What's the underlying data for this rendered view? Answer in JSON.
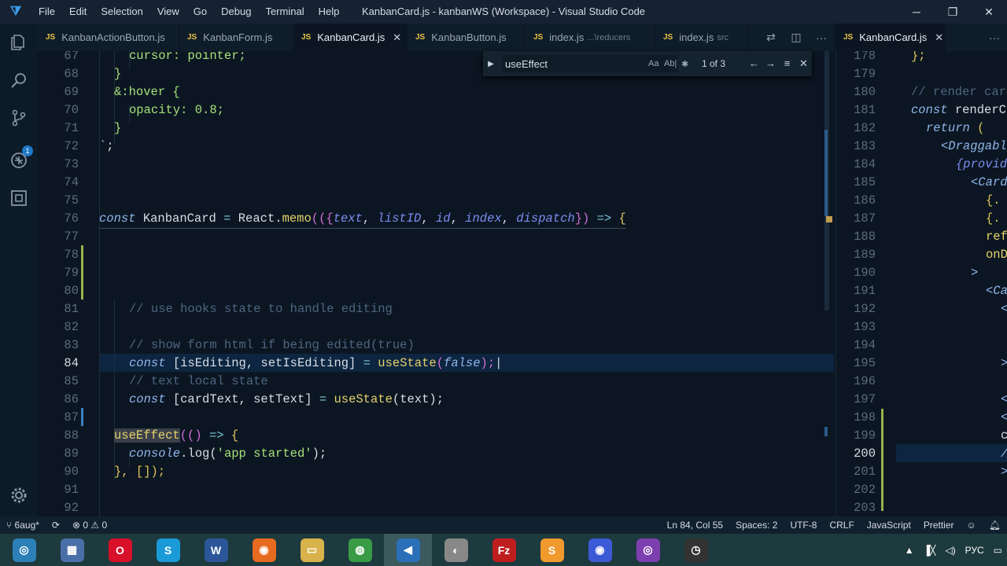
{
  "window": {
    "title": "KanbanCard.js - kanbanWS (Workspace) - Visual Studio Code",
    "menu": [
      "File",
      "Edit",
      "Selection",
      "View",
      "Go",
      "Debug",
      "Terminal",
      "Help"
    ],
    "minimize": "─",
    "restore": "❐",
    "close": "✕"
  },
  "tabs": [
    {
      "name": "KanbanActionButton.js",
      "sub": ""
    },
    {
      "name": "KanbanForm.js",
      "sub": ""
    },
    {
      "name": "KanbanCard.js",
      "sub": ""
    },
    {
      "name": "KanbanButton.js",
      "sub": ""
    },
    {
      "name": "index.js",
      "sub": "...\\reducers"
    },
    {
      "name": "index.js",
      "sub": "src"
    }
  ],
  "tabs2": [
    {
      "name": "KanbanCard.js"
    }
  ],
  "js_label": "JS",
  "close_glyph": "✕",
  "more_glyph": "···",
  "find": {
    "query": "useEffect",
    "case_opt": "Aa",
    "word_opt": "Ab|",
    "regex_opt": "✱",
    "result": "1 of 3",
    "prev": "←",
    "next": "→",
    "sel": "≡",
    "close": "✕"
  },
  "activity_badge": "1",
  "lines_left": [
    "67",
    "68",
    "69",
    "70",
    "71",
    "72",
    "73",
    "74",
    "75",
    "76",
    "77",
    "78",
    "79",
    "80",
    "81",
    "82",
    "83",
    "84",
    "85",
    "86",
    "87",
    "88",
    "89",
    "90",
    "91",
    "92"
  ],
  "lines_right": [
    "178",
    "179",
    "180",
    "181",
    "182",
    "183",
    "184",
    "185",
    "186",
    "187",
    "188",
    "189",
    "190",
    "191",
    "192",
    "193",
    "194",
    "195",
    "196",
    "197",
    "198",
    "199",
    "200",
    "201",
    "202",
    "203"
  ],
  "code": {
    "l67": "cursor: pointer;",
    "l68": "}",
    "l69a": "&:hover",
    "l69b": " {",
    "l70": "opacity: 0.8;",
    "l71": "}",
    "l72": "`;",
    "l76_const": "const",
    "l76_name": " KanbanCard ",
    "l76_eq": "=",
    "l76_react": " React.",
    "l76_memo": "memo",
    "l76_open": "(({",
    "l76_text": "text",
    "l76_c1": ", ",
    "l76_list": "listID",
    "l76_c2": ", ",
    "l76_id": "id",
    "l76_c3": ", ",
    "l76_idx": "index",
    "l76_c4": ", ",
    "l76_disp": "dispatch",
    "l76_close": "})",
    "l76_arrow": " => ",
    "l76_brace": "{",
    "l81": "// use hooks state to handle editing",
    "l83": "// show form html if being edited(true)",
    "l84_const": "const",
    "l84_arr": " [isEditing, setIsEditing] ",
    "l84_eq": "=",
    "l84_fn": " useState",
    "l84_p": "(",
    "l84_false": "false",
    "l84_end": ");",
    "l85": "// text local state",
    "l86_const": "const",
    "l86_arr": " [cardText, setText] ",
    "l86_eq": "=",
    "l86_fn": " useState",
    "l86_p": "(text);",
    "l88_fn": "useEffect",
    "l88_a": "(() ",
    "l88_arrow": "=>",
    "l88_b": " {",
    "l89_console": "console",
    "l89_log": ".log(",
    "l89_str": "'app started'",
    "l89_end": ");",
    "l90": "}, []);"
  },
  "code_right": {
    "r178": "};",
    "r180": "// render car",
    "r181a": "const",
    "r181b": " renderC",
    "r182a": "return",
    "r182b": " (",
    "r183": "<Draggabl",
    "r184": "{provid",
    "r185": "<Card",
    "r186": "{.",
    "r187": "{.",
    "r188": "ref",
    "r189": "onDo",
    "r190": ">",
    "r191": "<Ca",
    "r192": "<",
    "r195": ">",
    "r197": "<",
    "r198": "<",
    "r199": "c",
    "r200": "/",
    "r201": ">"
  },
  "status": {
    "branch": "6aug*",
    "errors": "0",
    "warnings": "0",
    "position": "Ln 84, Col 55",
    "spaces": "Spaces: 2",
    "encoding": "UTF-8",
    "eol": "CRLF",
    "language": "JavaScript",
    "formatter": "Prettier"
  },
  "taskbar": {
    "apps": [
      {
        "name": "globe",
        "color": "#2d7fb8",
        "glyph": "◎"
      },
      {
        "name": "calculator",
        "color": "#4a6fa8",
        "glyph": "▦"
      },
      {
        "name": "opera",
        "color": "#d8102a",
        "glyph": "O"
      },
      {
        "name": "skype",
        "color": "#1a9bd7",
        "glyph": "S"
      },
      {
        "name": "word",
        "color": "#2b579a",
        "glyph": "W"
      },
      {
        "name": "firefox",
        "color": "#e66a1f",
        "glyph": "◉"
      },
      {
        "name": "explorer",
        "color": "#d8b24a",
        "glyph": "▭"
      },
      {
        "name": "chrome",
        "color": "#3a9b47",
        "glyph": "◍"
      },
      {
        "name": "vscode",
        "color": "#2a6fb8",
        "glyph": "◀"
      },
      {
        "name": "speaker",
        "color": "#888888",
        "glyph": "◐"
      },
      {
        "name": "filezilla",
        "color": "#bf1e1e",
        "glyph": "Fz"
      },
      {
        "name": "sublime",
        "color": "#f09a2d",
        "glyph": "S"
      },
      {
        "name": "firefox-dev",
        "color": "#3c5ad6",
        "glyph": "◉"
      },
      {
        "name": "tor",
        "color": "#7d3fb0",
        "glyph": "◎"
      },
      {
        "name": "clock",
        "color": "#333333",
        "glyph": "◷"
      }
    ],
    "lang": "РУС",
    "up_arrow": "▲"
  }
}
